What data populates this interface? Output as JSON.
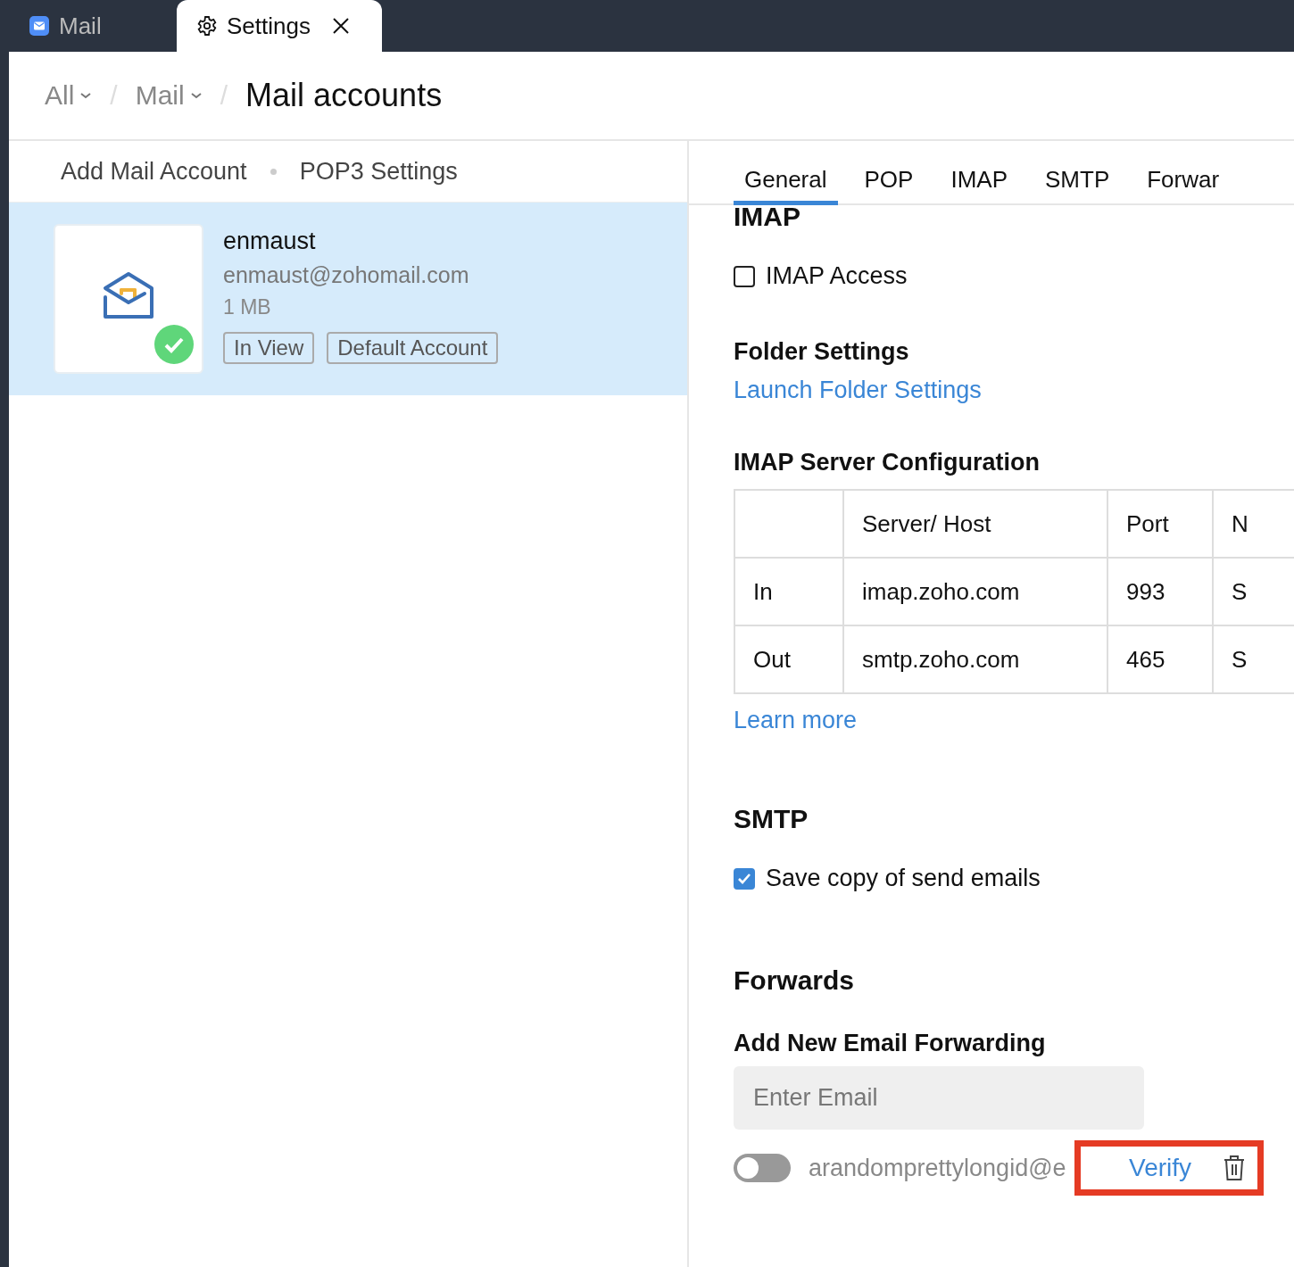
{
  "app_tabs": [
    {
      "label": "Mail",
      "selected": false,
      "closable": false
    },
    {
      "label": "Settings",
      "selected": true,
      "closable": true
    }
  ],
  "breadcrumb": [
    {
      "label": "All",
      "dropdown": true
    },
    {
      "separator": "/",
      "label": "Mail",
      "dropdown": true
    },
    {
      "separator": "/",
      "label": "Mail accounts",
      "dropdown": false
    }
  ],
  "left_toolbar": [
    "Add Mail Account",
    "POP3 Settings"
  ],
  "account": {
    "name": "enmaust",
    "email": "enmaust@zohomail.com",
    "size": "1 MB",
    "badges": [
      "In View",
      "Default Account"
    ],
    "selected": true,
    "verified": true
  },
  "settings_tabs": [
    {
      "label": "General",
      "selected": true
    },
    {
      "label": "POP",
      "selected": false
    },
    {
      "label": "IMAP",
      "selected": false
    },
    {
      "label": "SMTP",
      "selected": false
    },
    {
      "label": "Forwar",
      "selected": false
    }
  ],
  "imap": {
    "heading": "IMAP",
    "access": {
      "label": "IMAP Access",
      "checked": false
    },
    "folder_heading": "Folder Settings",
    "folder_link": "Launch Folder Settings",
    "config_heading": "IMAP Server Configuration",
    "table": {
      "columns": [
        "",
        "Server/ Host",
        "Port",
        "N"
      ],
      "rows": [
        [
          "In",
          "imap.zoho.com",
          "993",
          "S"
        ],
        [
          "Out",
          "smtp.zoho.com",
          "465",
          "S"
        ]
      ]
    },
    "learn_more": "Learn more"
  },
  "smtp": {
    "heading": "SMTP",
    "save_copy": {
      "label": "Save copy of send emails",
      "checked": true
    }
  },
  "forwards": {
    "heading": "Forwards",
    "add_heading": "Add New Email Forwarding",
    "email_field": {
      "placeholder": "Enter Email"
    },
    "entries": [
      {
        "email": "arandomprettylongid@e",
        "on": false,
        "action": "Verify",
        "highlighted": true
      }
    ]
  }
}
